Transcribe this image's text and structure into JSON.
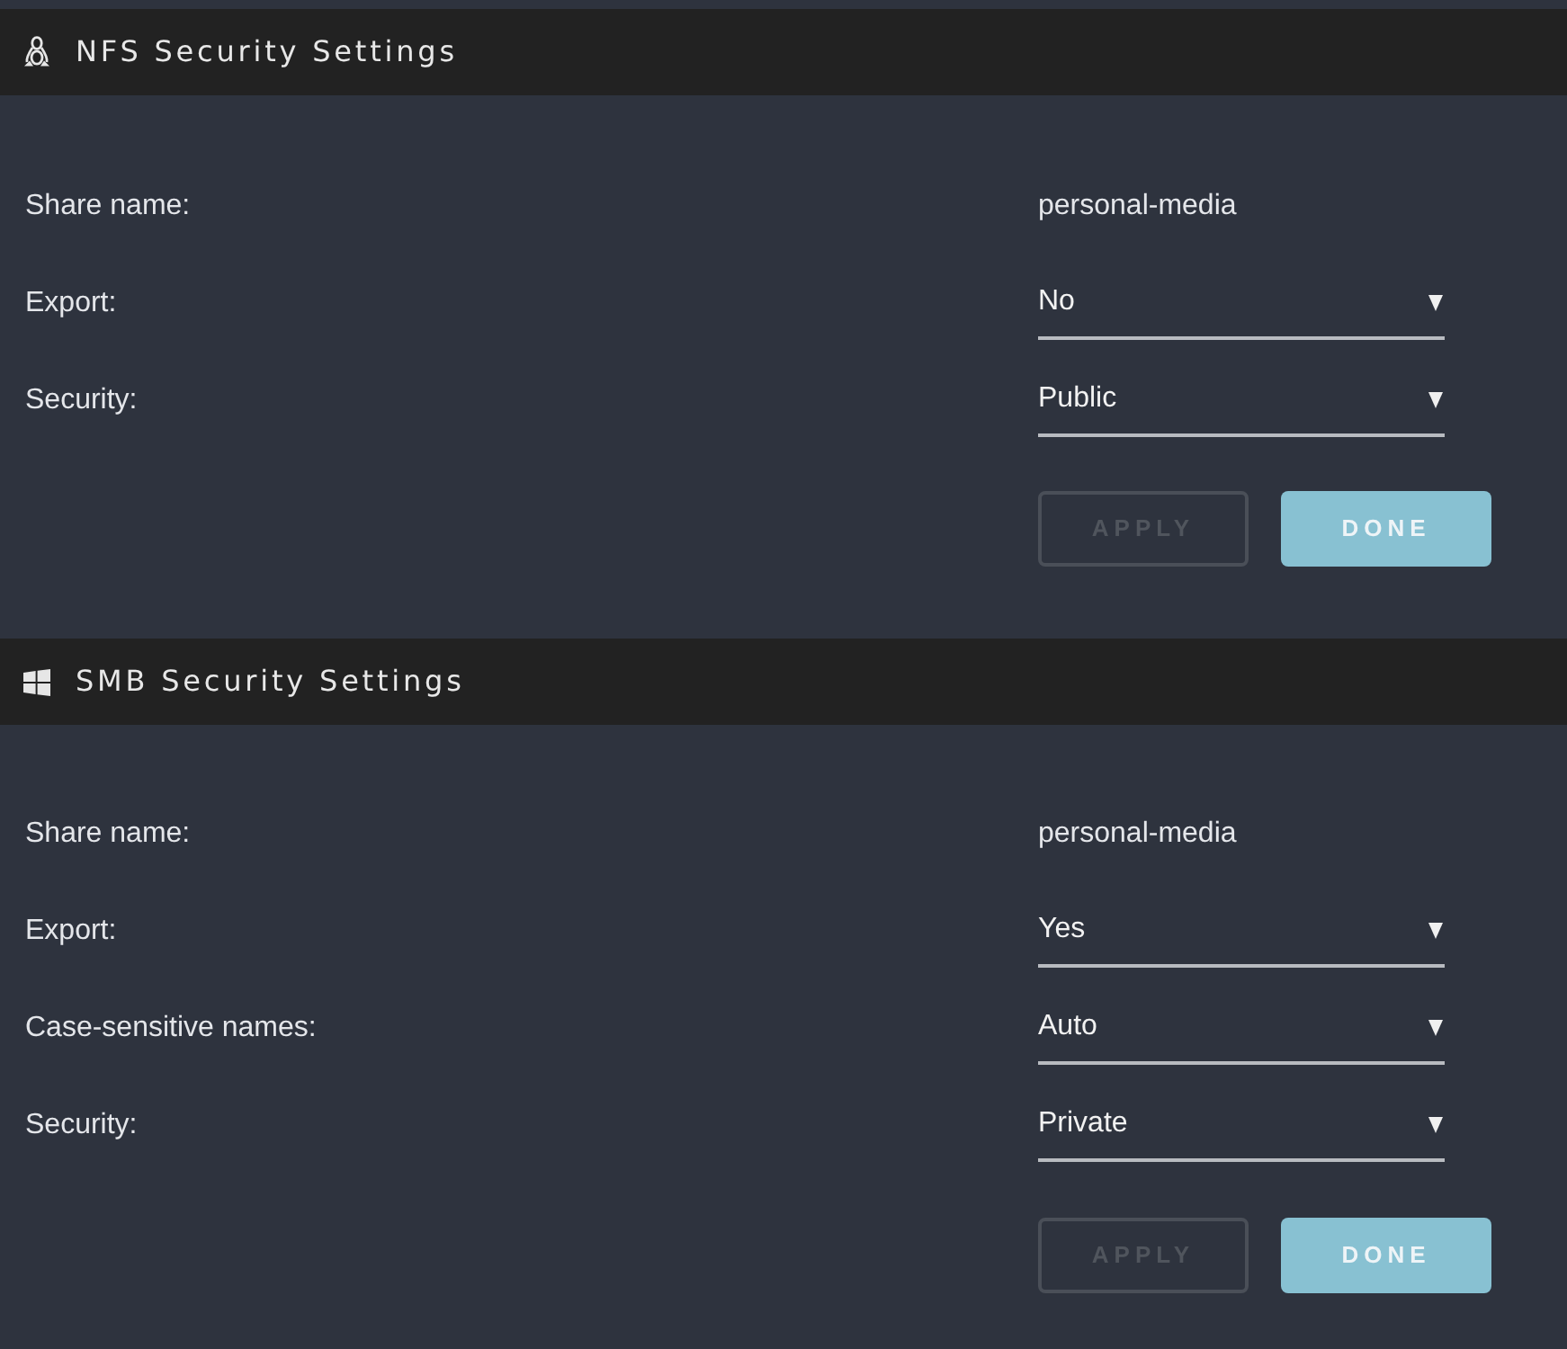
{
  "sections": [
    {
      "kind": "nfs",
      "title": "NFS Security Settings",
      "fields": [
        {
          "kind": "text",
          "label": "Share name:",
          "value": "personal-media"
        },
        {
          "kind": "select",
          "label": "Export:",
          "value": "No"
        },
        {
          "kind": "select",
          "label": "Security:",
          "value": "Public"
        }
      ],
      "buttons": [
        {
          "kind": "outline",
          "label": "APPLY",
          "disabled": true
        },
        {
          "kind": "primary",
          "label": "DONE",
          "disabled": false
        }
      ]
    },
    {
      "kind": "smb",
      "title": "SMB Security Settings",
      "fields": [
        {
          "kind": "text",
          "label": "Share name:",
          "value": "personal-media"
        },
        {
          "kind": "select",
          "label": "Export:",
          "value": "Yes"
        },
        {
          "kind": "select",
          "label": "Case-sensitive names:",
          "value": "Auto"
        },
        {
          "kind": "select",
          "label": "Security:",
          "value": "Private"
        }
      ],
      "buttons": [
        {
          "kind": "outline",
          "label": "APPLY",
          "disabled": true
        },
        {
          "kind": "primary",
          "label": "DONE",
          "disabled": false
        }
      ]
    }
  ]
}
